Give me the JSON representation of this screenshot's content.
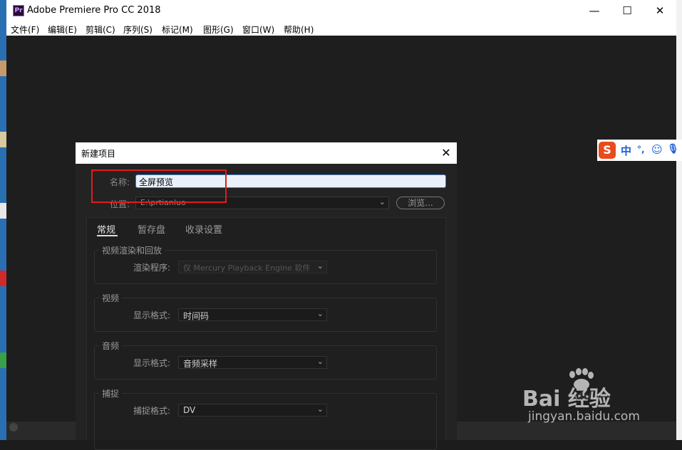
{
  "window": {
    "title": "Adobe Premiere Pro CC 2018",
    "app_icon_text": "Pr",
    "minimize": "—",
    "maximize": "☐",
    "close": "✕"
  },
  "menu": {
    "items": [
      "文件(F)",
      "编辑(E)",
      "剪辑(C)",
      "序列(S)",
      "标记(M)",
      "图形(G)",
      "窗口(W)",
      "帮助(H)"
    ]
  },
  "ime": {
    "logo": "S",
    "lang": "中",
    "punct": "°,",
    "emoji": "☺",
    "mic": "🎙"
  },
  "dialog": {
    "title": "新建项目",
    "close": "✕",
    "name_label": "名称:",
    "name_value": "全屏预览",
    "location_label": "位置:",
    "location_value": "E:\\prtianluo",
    "browse_label": "浏览...",
    "tabs": [
      "常规",
      "暂存盘",
      "收录设置"
    ],
    "groups": {
      "render": {
        "title": "视频渲染和回放",
        "field_label": "渲染程序:",
        "value": "仅 Mercury Playback Engine 软件"
      },
      "video": {
        "title": "视频",
        "field_label": "显示格式:",
        "value": "时间码"
      },
      "audio": {
        "title": "音频",
        "field_label": "显示格式:",
        "value": "音频采样"
      },
      "capture": {
        "title": "捕捉",
        "field_label": "捕捉格式:",
        "value": "DV"
      }
    }
  },
  "watermark": {
    "logo": "Bai  经验",
    "du": "du",
    "url": "jingyan.baidu.com"
  },
  "colors": {
    "highlight": "#e21b1b",
    "input_focus": "#3d7ec9",
    "ime_accent": "#1b5fd6"
  }
}
